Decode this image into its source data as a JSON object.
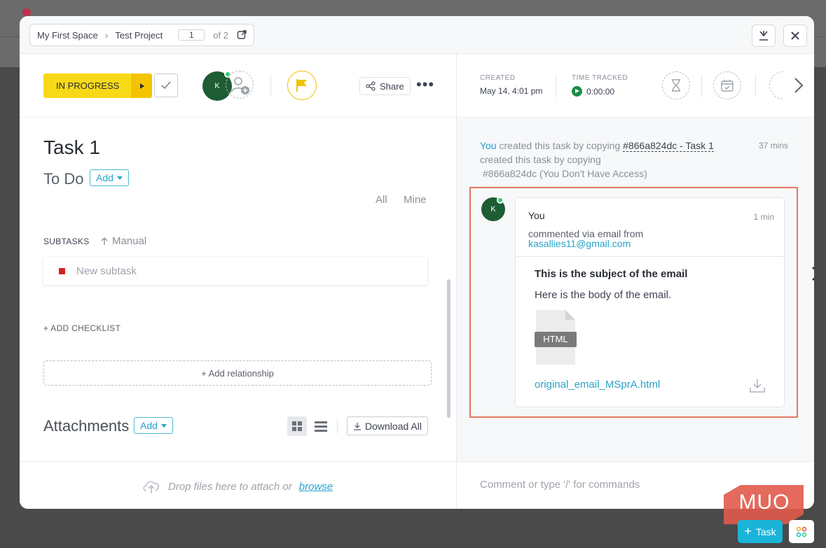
{
  "breadcrumb": {
    "space": "My First Space",
    "project": "Test Project",
    "page": "1",
    "of_total": "of 2"
  },
  "toolbar": {
    "status": "IN PROGRESS",
    "assignee_initial": "K",
    "share_label": "Share",
    "more_label": "•••"
  },
  "task": {
    "title": "Task 1",
    "todo_label": "To Do",
    "add_label": "Add",
    "filter_all": "All",
    "filter_mine": "Mine",
    "subtasks_label": "SUBTASKS",
    "manual_label": "Manual",
    "new_subtask_placeholder": "New subtask",
    "add_checklist": "+ ADD CHECKLIST",
    "add_relationship": "+ Add relationship",
    "attachments_label": "Attachments",
    "attachments_add": "Add",
    "download_all": "Download All"
  },
  "meta": {
    "created_label": "CREATED",
    "created_value": "May 14, 4:01 pm",
    "time_label": "TIME TRACKED",
    "time_value": "0:00:00"
  },
  "activity": {
    "actor": "You",
    "text1": " created this task by copying ",
    "ref": "#866a824dc - Task 1",
    "time": "37 mins",
    "line2": "created this task by copying",
    "line3": "#866a824dc (You Don't Have Access)"
  },
  "comment": {
    "avatar_initial": "K",
    "author": "You",
    "time": "1 min",
    "via": "commented via email from",
    "email": "kasallies11@gmail.com",
    "subject": "This is the subject of the email",
    "body": "Here is the body of the email.",
    "file_type": "HTML",
    "file_name": "original_email_MSprA.html"
  },
  "footer": {
    "drop_text": "Drop files here to attach or",
    "browse": "browse",
    "comment_placeholder": "Comment or type '/' for commands"
  },
  "watermark": "MUO",
  "fab": {
    "task_label": "Task",
    "task_plus": "+"
  },
  "colors": {
    "accent": "#28a3c9",
    "status_yellow": "#f7d918",
    "highlight": "#e07a5f",
    "avatar": "#1e5c34"
  }
}
